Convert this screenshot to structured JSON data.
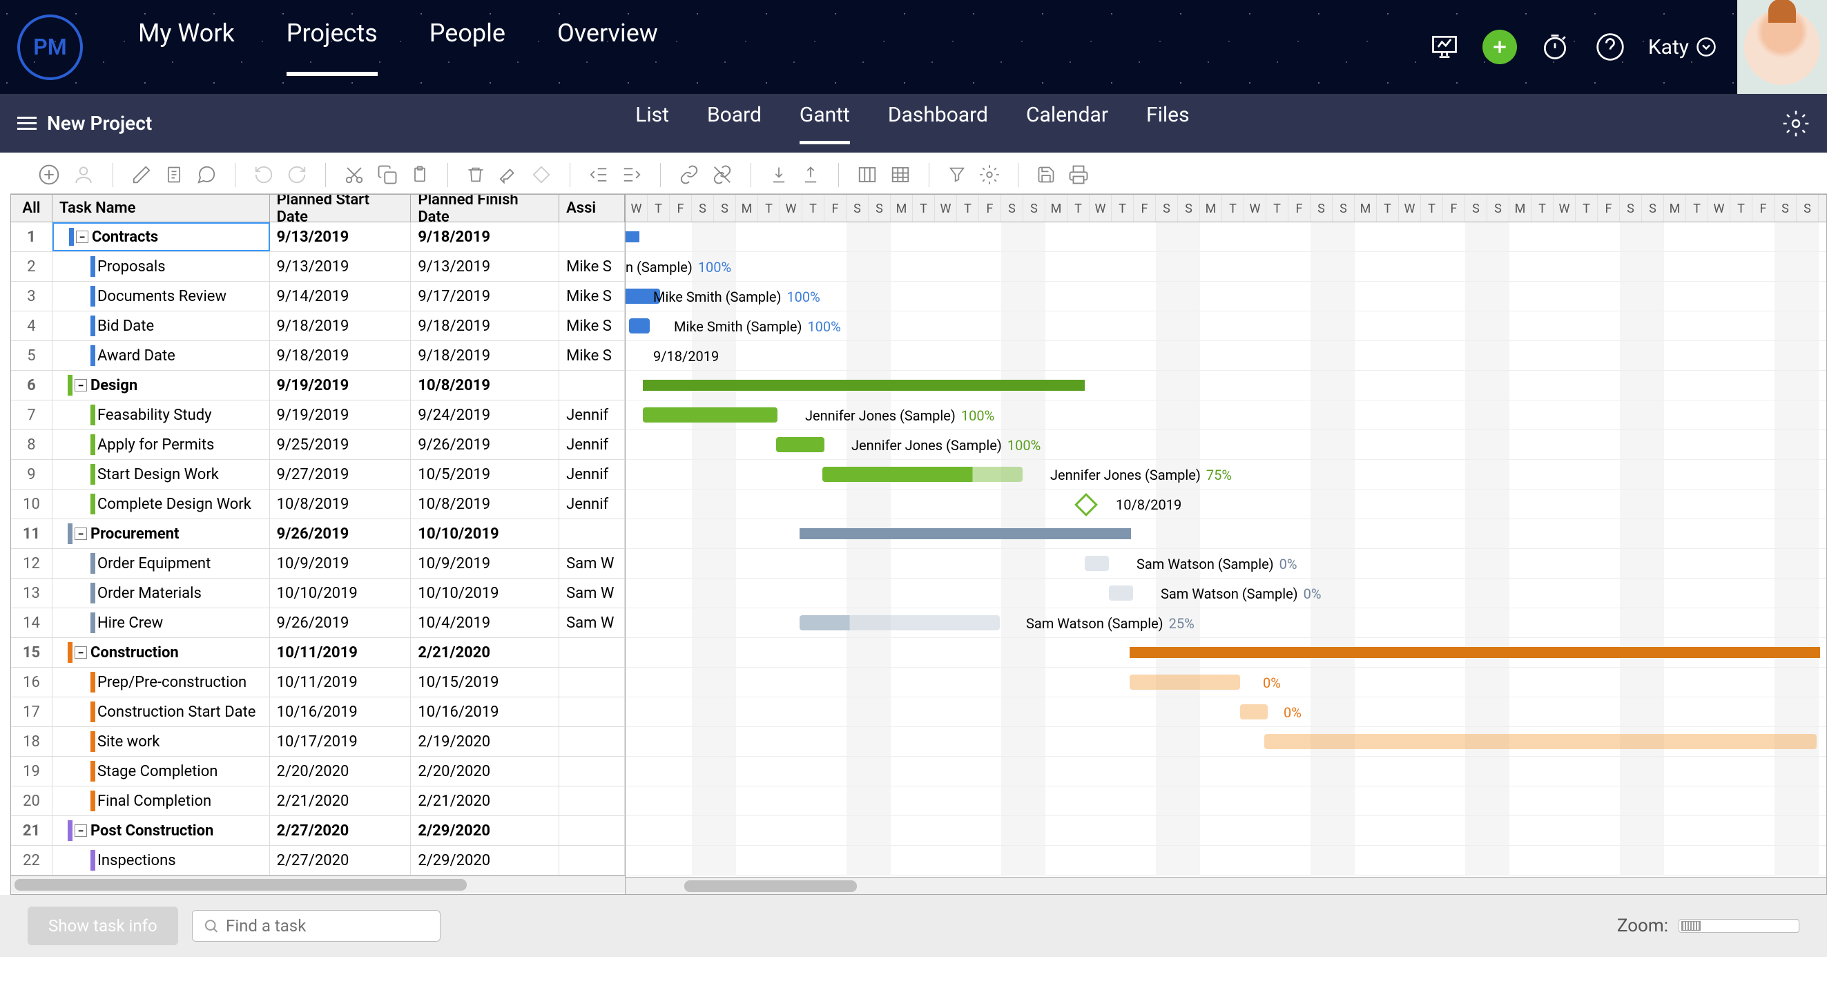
{
  "logo_text": "PM",
  "main_nav": [
    "My Work",
    "Projects",
    "People",
    "Overview"
  ],
  "main_nav_active": 1,
  "user_name": "Katy",
  "project_name": "New Project",
  "view_tabs": [
    "List",
    "Board",
    "Gantt",
    "Dashboard",
    "Calendar",
    "Files"
  ],
  "view_tab_active": 2,
  "columns": {
    "all": "All",
    "name": "Task Name",
    "start": "Planned Start Date",
    "finish": "Planned Finish Date",
    "assign": "Assi"
  },
  "day_headers": [
    "W",
    "T",
    "F",
    "S",
    "S",
    "M",
    "T",
    "W",
    "T",
    "F",
    "S",
    "S",
    "M",
    "T",
    "W",
    "T",
    "F",
    "S",
    "S",
    "M",
    "T",
    "W",
    "T",
    "F",
    "S",
    "S",
    "M",
    "T",
    "W",
    "T",
    "F",
    "S",
    "S",
    "M",
    "T",
    "W",
    "T",
    "F",
    "S",
    "S",
    "M",
    "T",
    "W",
    "T",
    "F",
    "S",
    "S",
    "M",
    "T",
    "W",
    "T",
    "F",
    "S",
    "S"
  ],
  "rows": [
    {
      "n": 1,
      "name": "Contracts",
      "start": "9/13/2019",
      "finish": "9/18/2019",
      "assign": "",
      "type": "summary",
      "color": "blue",
      "selected": true
    },
    {
      "n": 2,
      "name": "Proposals",
      "start": "9/13/2019",
      "finish": "9/13/2019",
      "assign": "Mike S",
      "type": "task",
      "color": "blue"
    },
    {
      "n": 3,
      "name": "Documents Review",
      "start": "9/14/2019",
      "finish": "9/17/2019",
      "assign": "Mike S",
      "type": "task",
      "color": "blue"
    },
    {
      "n": 4,
      "name": "Bid Date",
      "start": "9/18/2019",
      "finish": "9/18/2019",
      "assign": "Mike S",
      "type": "task",
      "color": "blue"
    },
    {
      "n": 5,
      "name": "Award Date",
      "start": "9/18/2019",
      "finish": "9/18/2019",
      "assign": "Mike S",
      "type": "milestone",
      "color": "blue"
    },
    {
      "n": 6,
      "name": "Design",
      "start": "9/19/2019",
      "finish": "10/8/2019",
      "assign": "",
      "type": "summary",
      "color": "green"
    },
    {
      "n": 7,
      "name": "Feasability Study",
      "start": "9/19/2019",
      "finish": "9/24/2019",
      "assign": "Jennif",
      "type": "task",
      "color": "green"
    },
    {
      "n": 8,
      "name": "Apply for Permits",
      "start": "9/25/2019",
      "finish": "9/26/2019",
      "assign": "Jennif",
      "type": "task",
      "color": "green"
    },
    {
      "n": 9,
      "name": "Start Design Work",
      "start": "9/27/2019",
      "finish": "10/5/2019",
      "assign": "Jennif",
      "type": "task",
      "color": "green"
    },
    {
      "n": 10,
      "name": "Complete Design Work",
      "start": "10/8/2019",
      "finish": "10/8/2019",
      "assign": "Jennif",
      "type": "milestone",
      "color": "green"
    },
    {
      "n": 11,
      "name": "Procurement",
      "start": "9/26/2019",
      "finish": "10/10/2019",
      "assign": "",
      "type": "summary",
      "color": "slate"
    },
    {
      "n": 12,
      "name": "Order Equipment",
      "start": "10/9/2019",
      "finish": "10/9/2019",
      "assign": "Sam W",
      "type": "task",
      "color": "slate"
    },
    {
      "n": 13,
      "name": "Order Materials",
      "start": "10/10/2019",
      "finish": "10/10/2019",
      "assign": "Sam W",
      "type": "task",
      "color": "slate"
    },
    {
      "n": 14,
      "name": "Hire Crew",
      "start": "9/26/2019",
      "finish": "10/4/2019",
      "assign": "Sam W",
      "type": "task",
      "color": "slate"
    },
    {
      "n": 15,
      "name": "Construction",
      "start": "10/11/2019",
      "finish": "2/21/2020",
      "assign": "",
      "type": "summary",
      "color": "orange"
    },
    {
      "n": 16,
      "name": "Prep/Pre-construction",
      "start": "10/11/2019",
      "finish": "10/15/2019",
      "assign": "",
      "type": "task",
      "color": "orange"
    },
    {
      "n": 17,
      "name": "Construction Start Date",
      "start": "10/16/2019",
      "finish": "10/16/2019",
      "assign": "",
      "type": "task",
      "color": "orange"
    },
    {
      "n": 18,
      "name": "Site work",
      "start": "10/17/2019",
      "finish": "2/19/2020",
      "assign": "",
      "type": "task",
      "color": "orange"
    },
    {
      "n": 19,
      "name": "Stage Completion",
      "start": "2/20/2020",
      "finish": "2/20/2020",
      "assign": "",
      "type": "task",
      "color": "orange"
    },
    {
      "n": 20,
      "name": "Final Completion",
      "start": "2/21/2020",
      "finish": "2/21/2020",
      "assign": "",
      "type": "task",
      "color": "orange"
    },
    {
      "n": 21,
      "name": "Post Construction",
      "start": "2/27/2020",
      "finish": "2/29/2020",
      "assign": "",
      "type": "summary",
      "color": "purple"
    },
    {
      "n": 22,
      "name": "Inspections",
      "start": "2/27/2020",
      "finish": "2/29/2020",
      "assign": "",
      "type": "task",
      "color": "purple"
    }
  ],
  "gantt_labels": [
    {
      "row": 1,
      "text": "n (Sample)",
      "pct": "100%",
      "class": ""
    },
    {
      "row": 2,
      "text": "Mike Smith (Sample)",
      "pct": "100%",
      "class": ""
    },
    {
      "row": 3,
      "text": "Mike Smith (Sample)",
      "pct": "100%",
      "class": ""
    },
    {
      "row": 4,
      "text": "9/18/2019",
      "pct": "",
      "class": ""
    },
    {
      "row": 6,
      "text": "Jennifer Jones (Sample)",
      "pct": "100%",
      "class": "green"
    },
    {
      "row": 7,
      "text": "Jennifer Jones (Sample)",
      "pct": "100%",
      "class": "green"
    },
    {
      "row": 8,
      "text": "Jennifer Jones (Sample)",
      "pct": "75%",
      "class": "green"
    },
    {
      "row": 9,
      "text": "10/8/2019",
      "pct": "",
      "class": ""
    },
    {
      "row": 11,
      "text": "Sam Watson (Sample)",
      "pct": "0%",
      "class": "slate"
    },
    {
      "row": 12,
      "text": "Sam Watson (Sample)",
      "pct": "0%",
      "class": "slate"
    },
    {
      "row": 13,
      "text": "Sam Watson (Sample)",
      "pct": "25%",
      "class": "slate"
    },
    {
      "row": 15,
      "text": "",
      "pct": "0%",
      "class": "orange"
    },
    {
      "row": 16,
      "text": "",
      "pct": "0%",
      "class": "orange"
    }
  ],
  "footer": {
    "show_info": "Show task info",
    "search_ph": "Find a task",
    "zoom_label": "Zoom:"
  }
}
